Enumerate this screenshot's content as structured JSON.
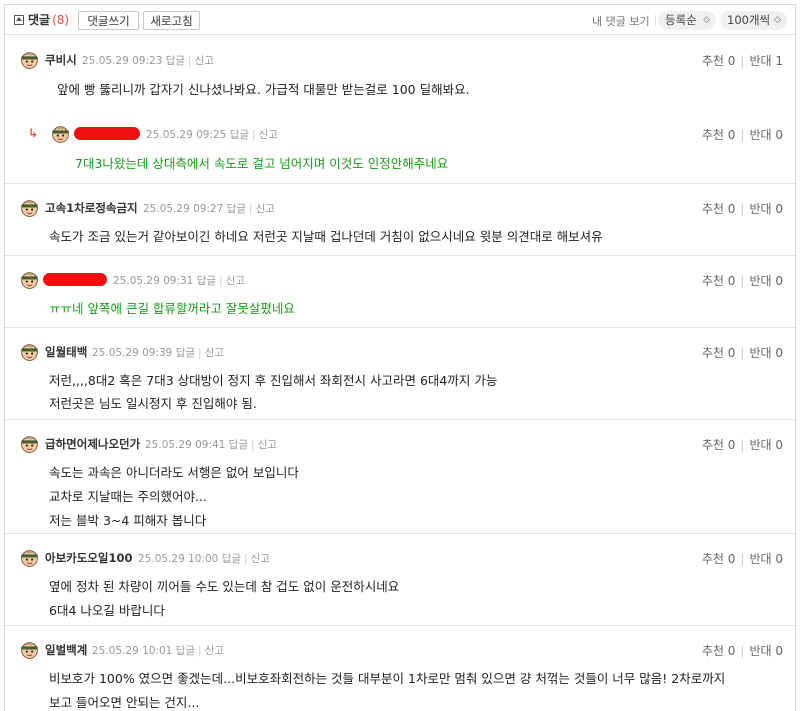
{
  "toolbar": {
    "comment_label": "댓글",
    "comment_count": "(8)",
    "write_button": "댓글쓰기",
    "refresh_button": "새로고침",
    "my_comments": "내 댓글 보기",
    "sort_value": "등록순",
    "per_page_value": "100개씩"
  },
  "action_labels": {
    "reply": "답글",
    "report": "신고",
    "up": "추천",
    "down": "반대"
  },
  "comments": [
    {
      "nickname": "쿠비시",
      "timestamp": "25.05.29 09:23",
      "up": "0",
      "down": "1",
      "is_reply": false,
      "redacted": false,
      "green": false,
      "lines": [
        "앞에 빵 뚫리니까 갑자기 신나셨나봐요. 가급적 대물만 받는걸로 100 딜해봐요."
      ]
    },
    {
      "nickname": "",
      "timestamp": "25.05.29 09:25",
      "up": "0",
      "down": "0",
      "is_reply": true,
      "redacted": true,
      "green": true,
      "lines": [
        "7대3나왔는데 상대측에서 속도로 걸고 넘어지며 이것도 인정안해주네요"
      ]
    },
    {
      "nickname": "고속1차로정속금지",
      "timestamp": "25.05.29 09:27",
      "up": "0",
      "down": "0",
      "is_reply": false,
      "redacted": false,
      "green": false,
      "lines": [
        "속도가 조금 있는거 같아보이긴 하네요 저런곳 지날때 겁나던데 거침이 없으시네요 윗분 의견대로 해보셔유"
      ]
    },
    {
      "nickname": "",
      "timestamp": "25.05.29 09:31",
      "up": "0",
      "down": "0",
      "is_reply": false,
      "redacted": true,
      "green": true,
      "lines": [
        "ㅠㅠ네 앞쪽에 큰길 합류할꺼라고 잘못살폈네요"
      ]
    },
    {
      "nickname": "일월태백",
      "timestamp": "25.05.29 09:39",
      "up": "0",
      "down": "0",
      "is_reply": false,
      "redacted": false,
      "green": false,
      "lines": [
        "저런,,,,8대2 혹은 7대3 상대방이 정지 후 진입해서 좌회전시 사고라면 6대4까지 가능",
        "저런곳은 님도 일시정지 후 진입해야 됨."
      ]
    },
    {
      "nickname": "급하면어제나오던가",
      "timestamp": "25.05.29 09:41",
      "up": "0",
      "down": "0",
      "is_reply": false,
      "redacted": false,
      "green": false,
      "lines": [
        "속도는 과속은 아니더라도 서행은 없어 보입니다",
        "교차로 지날때는 주의했어야...",
        "저는 블박 3~4 피해자 봅니다"
      ]
    },
    {
      "nickname": "아보카도오일100",
      "timestamp": "25.05.29 10:00",
      "up": "0",
      "down": "0",
      "is_reply": false,
      "redacted": false,
      "green": false,
      "lines": [
        "옆에 정차 된 차량이 끼어들 수도 있는데 참 겁도 없이 운전하시네요",
        "6대4 나오길 바랍니다"
      ]
    },
    {
      "nickname": "일벌백계",
      "timestamp": "25.05.29 10:01",
      "up": "0",
      "down": "0",
      "is_reply": false,
      "redacted": false,
      "green": false,
      "lines": [
        "비보호가 100% 였으면 좋겠는데...비보호좌회전하는 것들 대부분이 1차로만 멈춰 있으면 걍 처꺾는 것들이 너무 많음! 2차로까지",
        "보고 들어오면 안되는 건지..."
      ]
    }
  ],
  "colors": {
    "accent": "#e0533a",
    "green_text": "#1a9a1a",
    "redaction": "#ef1010"
  }
}
